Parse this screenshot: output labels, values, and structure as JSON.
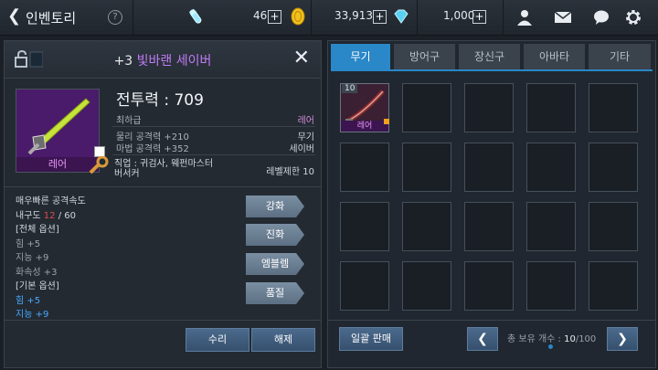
{
  "header": {
    "title": "인벤토리",
    "help": "?",
    "currency1": "46",
    "currency2": "33,913",
    "currency3": "1,000",
    "plus": "+"
  },
  "detail": {
    "level_badge": "10",
    "enhance": "+3",
    "name": "빛바랜 세이버",
    "rarity_label": "레어",
    "combat_power": "전투력 : 709",
    "grade": "최하급",
    "grade_value": "레어",
    "stat1": "물리 공격력 +210",
    "stat1_value": "무기",
    "stat2": "마법 공격력 +352",
    "stat2_value": "세이버",
    "job": "직업 : 귀검사, 웨펀마스터 버서커",
    "level_req": "레벨제한 10",
    "options": {
      "speed": "매우빠른 공격속도",
      "dur_label": "내구도 ",
      "dur_cur": "12",
      "dur_max": " / 60",
      "sec1": "[전체 옵션]",
      "o1": "힘 +5",
      "o2": "지능 +9",
      "o3": "화속성 +3",
      "sec2": "[기본 옵션]",
      "o4": "힘 +5",
      "o5": "지능 +9"
    },
    "buttons": [
      "강화",
      "진화",
      "엠블렘",
      "품질"
    ],
    "repair": "수리",
    "unequip": "해제"
  },
  "inventory": {
    "tabs": [
      "무기",
      "방어구",
      "장신구",
      "아바타",
      "기타"
    ],
    "active_tab": 0,
    "slot_level": "10",
    "slot_rarity": "레어",
    "sell_all": "일괄 판매",
    "count_label": "총 보유 개수 : ",
    "count_value": "10",
    "count_max": "/100"
  },
  "colors": {
    "accent": "#2a87c8",
    "rare": "#c07cf5",
    "durability_low": "#e24a4a"
  }
}
